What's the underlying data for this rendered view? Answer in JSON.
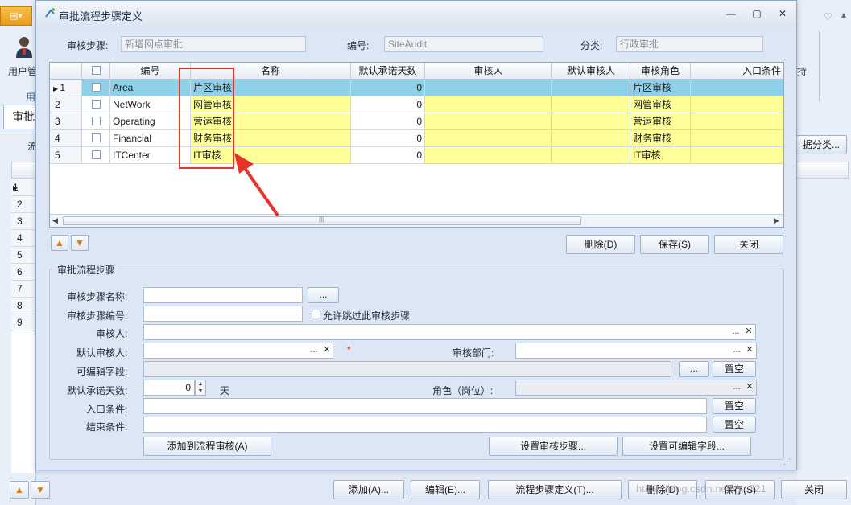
{
  "background_app": {
    "ribbon_user_label": "用户管",
    "ribbon_group_label": "用",
    "ribbon_right_label": "持",
    "tab_label": "审批",
    "left_label": "流",
    "right_button": "据分类...",
    "rows": [
      "1",
      "2",
      "3",
      "4",
      "5",
      "6",
      "7",
      "8",
      "9"
    ],
    "bottom_buttons": {
      "add": "添加(A)...",
      "edit": "编辑(E)...",
      "define": "流程步骤定义(T)...",
      "delete": "删除(D)",
      "save": "保存(S)",
      "close": "关闭"
    },
    "watermark": "https://blog.csdn.net/cxu321"
  },
  "dialog": {
    "title": "审批流程步骤定义",
    "header": {
      "step_label": "审核步骤:",
      "step_value": "新增网点审批",
      "code_label": "编号:",
      "code_value": "SiteAudit",
      "category_label": "分类:",
      "category_value": "行政审批"
    },
    "grid": {
      "columns": [
        "编号",
        "名称",
        "默认承诺天数",
        "审核人",
        "默认审核人",
        "审核角色",
        "入口条件"
      ],
      "rows": [
        {
          "index": "1",
          "code": "Area",
          "name": "片区审核",
          "days": "0",
          "role": "片区审核"
        },
        {
          "index": "2",
          "code": "NetWork",
          "name": "网管审核",
          "days": "0",
          "role": "网管审核"
        },
        {
          "index": "3",
          "code": "Operating",
          "name": "营运审核",
          "days": "0",
          "role": "营运审核"
        },
        {
          "index": "4",
          "code": "Financial",
          "name": "财务审核",
          "days": "0",
          "role": "财务审核"
        },
        {
          "index": "5",
          "code": "ITCenter",
          "name": "IT审核",
          "days": "0",
          "role": "IT审核"
        }
      ],
      "selected_row": 1
    },
    "actions": {
      "delete": "删除(D)",
      "save": "保存(S)",
      "close": "关闭"
    },
    "form": {
      "section_title": "审批流程步骤",
      "step_name_label": "审核步骤名称:",
      "step_code_label": "审核步骤编号:",
      "allow_skip_label": "允许跳过此审核步骤",
      "auditor_label": "审核人:",
      "default_auditor_label": "默认审核人:",
      "required_mark": "*",
      "dept_label": "审核部门:",
      "editable_fields_label": "可编辑字段:",
      "days_label": "默认承诺天数:",
      "days_value": "0",
      "days_unit": "天",
      "role_label": "角色（岗位）:",
      "entry_condition_label": "入口条件:",
      "end_condition_label": "结束条件:",
      "ellipsis": "...",
      "clear": "置空",
      "add_to_flow": "添加到流程审核(A)",
      "set_steps": "设置审核步骤...",
      "set_editable": "设置可编辑字段..."
    }
  },
  "colors": {
    "selected_row": "#8dd0e8",
    "yellow_cell": "#ffff99",
    "highlight_box": "#e8322a"
  }
}
